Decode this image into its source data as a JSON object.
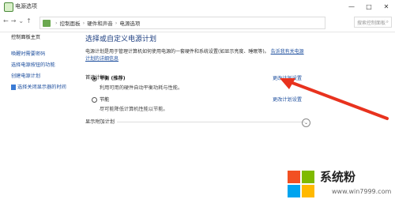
{
  "window": {
    "title": "电源选项",
    "minimize": "—",
    "maximize": "□",
    "close": "✕"
  },
  "nav": {
    "back": "←",
    "forward": "→",
    "recent": "⌄",
    "up": "↑",
    "breadcrumb": [
      "控制面板",
      "硬件和声音",
      "电源选项"
    ],
    "search_placeholder": "搜索控制面板"
  },
  "sidebar": {
    "home": "控制面板主页",
    "links": [
      "唤醒时需要密码",
      "选择电源按钮的功能",
      "创建电源计划",
      "选择关闭显示器的时间"
    ]
  },
  "main": {
    "heading": "选择或自定义电源计划",
    "description": "电源计划是用于管理计算机如何使用电源的一套硬件和系统设置(如显示亮度、睡眠等)。",
    "description_link": "告诉我有关电源计划的详细信息",
    "section_label": "首选计划",
    "plans": [
      {
        "name": "平衡 (推荐)",
        "detail": "利用可用的硬件自动平衡功耗与性能。",
        "selected": true,
        "change_link": "更改计划设置"
      },
      {
        "name": "节能",
        "detail": "尽可能降低计算机性能以节能。",
        "selected": false,
        "change_link": "更改计划设置"
      }
    ],
    "expander_label": "显示附加计划"
  },
  "watermark": {
    "brand": "系统粉",
    "url": "www.win7999.com",
    "colors": [
      "#f25022",
      "#7fba00",
      "#00a4ef",
      "#ffb900"
    ]
  },
  "arrow_color": "#e8321e"
}
